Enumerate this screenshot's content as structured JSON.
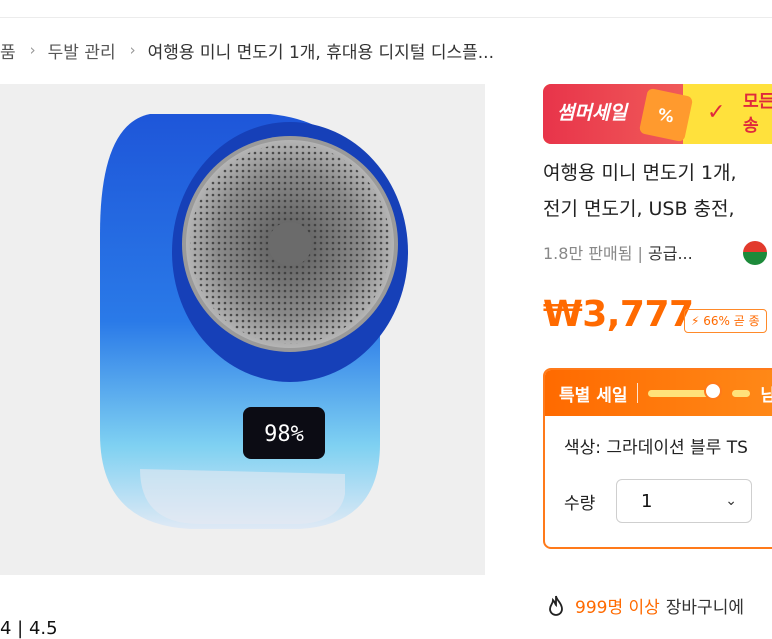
{
  "breadcrumb": {
    "items": [
      "품",
      "두발 관리",
      "여행용 미니 면도기 1개, 휴대용 디지털 디스플..."
    ]
  },
  "product": {
    "image_display": "98%",
    "rating_partial": "4 | 4.5",
    "banner": {
      "left": "썸머세일",
      "pct": "%",
      "side_line1": "모든",
      "side_line2": "송"
    },
    "title_line1": "여행용 미니 면도기 1개,",
    "title_line2": "전기 면도기, USB 충전,",
    "sold": "1.8만 판매됨",
    "supplier": "공급...",
    "price": "₩3,777",
    "price_badge": "66% 곧 종",
    "deal": {
      "label": "특별 세일",
      "rest": "남"
    },
    "color_option": "색상: 그라데이션 블루 TS",
    "qty_label": "수량",
    "qty_value": "1",
    "cart_note": {
      "count": "999명 이상",
      "text": "장바구니에"
    }
  }
}
